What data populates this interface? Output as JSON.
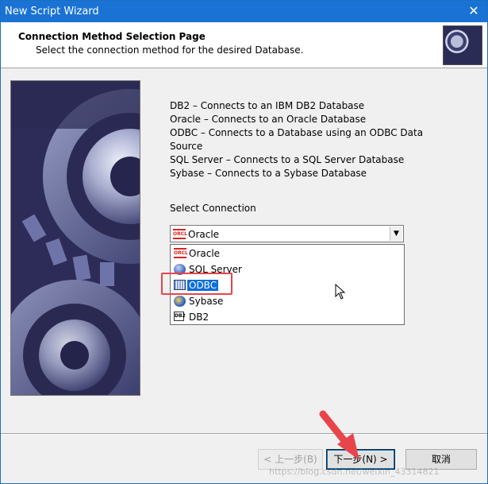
{
  "window": {
    "title": "New Script Wizard",
    "close_glyph": "✕"
  },
  "header": {
    "title": "Connection Method Selection Page",
    "subtitle": "Select the connection method for the desired Database."
  },
  "description": {
    "lines": [
      "DB2 – Connects to an IBM DB2 Database",
      "Oracle – Connects to an Oracle Database",
      "ODBC – Connects to a Database using an ODBC Data",
      "Source",
      "SQL Server – Connects to a SQL Server Database",
      "Sybase – Connects to a Sybase Database"
    ]
  },
  "connection": {
    "label": "Select Connection",
    "selected_value": "Oracle",
    "selected_icon": "oracle-icon",
    "options": [
      {
        "label": "Oracle",
        "icon": "oracle-icon"
      },
      {
        "label": "SQL Server",
        "icon": "sql-server-icon"
      },
      {
        "label": "ODBC",
        "icon": "odbc-icon",
        "highlighted": true
      },
      {
        "label": "Sybase",
        "icon": "sybase-icon"
      },
      {
        "label": "DB2",
        "icon": "db2-icon"
      }
    ]
  },
  "icons": {
    "oracle_text": "ORCL",
    "db2_text": "DB2"
  },
  "buttons": {
    "back": "< 上一步(B)",
    "next": "下一步(N) >",
    "cancel": "取消"
  },
  "watermark": "https://blog.csdn.net/weixin_43314821",
  "colors": {
    "titlebar": "#1a73d4",
    "selection": "#0a6edc",
    "annotation_red": "#e8454a"
  }
}
